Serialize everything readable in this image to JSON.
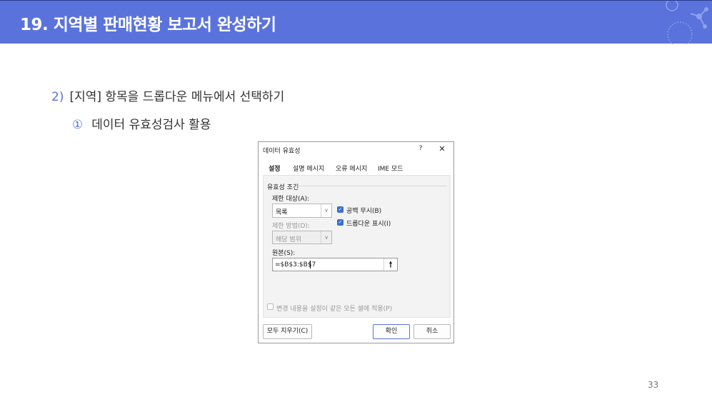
{
  "slide": {
    "title": "19. 지역별 판매현황 보고서 완성하기",
    "step_number": "2)",
    "step_text": "[지역] 항목을 드롭다운 메뉴에서 선택하기",
    "substep_number": "①",
    "substep_text": "데이터 유효성검사 활용",
    "page_number": "33"
  },
  "dialog": {
    "title": "데이터 유효성",
    "help_label": "?",
    "close_label": "✕",
    "tabs": [
      {
        "label": "설정",
        "active": true
      },
      {
        "label": "설명 메시지",
        "active": false
      },
      {
        "label": "오류 메시지",
        "active": false
      },
      {
        "label": "IME 모드",
        "active": false
      }
    ],
    "section_label": "유효성 조건",
    "allow_label": "제한 대상(A):",
    "allow_value": "목록",
    "ignore_blank_label": "공백 무시(B)",
    "ignore_blank_checked": true,
    "dropdown_label": "드롭다운 표시(I)",
    "dropdown_checked": true,
    "data_label": "제한 방법(D):",
    "data_value": "해당 범위",
    "source_label": "원본(S):",
    "source_value": "=$B$3:$B$7",
    "apply_all_label": "변경 내용을 설정이 같은 모든 셀에 적용(P)",
    "apply_all_checked": false,
    "clear_all_label": "모두 지우기(C)",
    "ok_label": "확인",
    "cancel_label": "취소"
  },
  "colors": {
    "header_bg": "#5a73dc",
    "accent": "#5a73dc",
    "checkbox": "#3a6fd0"
  }
}
